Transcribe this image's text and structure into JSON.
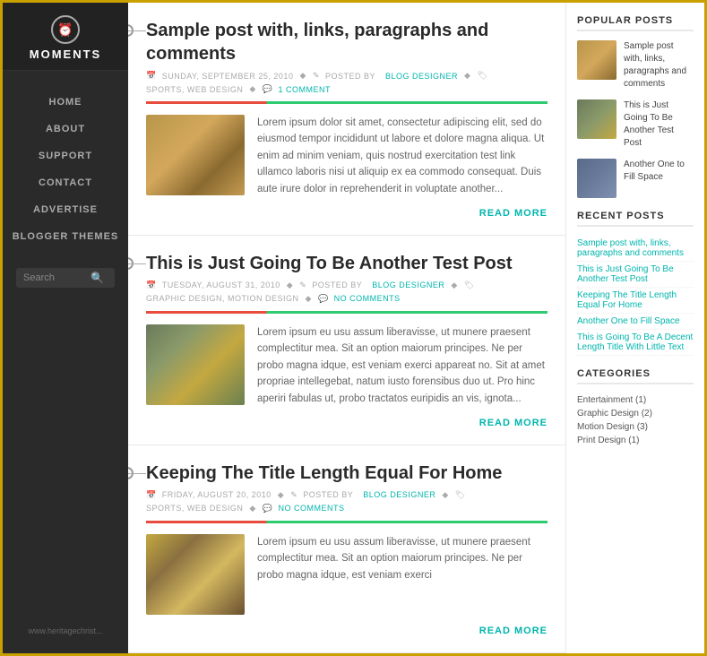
{
  "sidebar": {
    "logo_text": "MOMENTS",
    "nav_items": [
      "HOME",
      "ABOUT",
      "SUPPORT",
      "CONTACT",
      "ADVERTISE",
      "BLOGGER THEMES"
    ],
    "search_placeholder": "Search",
    "url_text": "www.heritagechrist..."
  },
  "posts": [
    {
      "id": 1,
      "title": "Sample post with, links, paragraphs and comments",
      "date": "SUNDAY, SEPTEMBER 25, 2010",
      "author": "BLOG DESIGNER",
      "tags": "SPORTS, WEB DESIGN",
      "comments": "1 COMMENT",
      "excerpt": "Lorem ipsum dolor sit amet, consectetur adipiscing elit, sed do eiusmod tempor incididunt ut labore et dolore magna aliqua. Ut enim ad minim veniam, quis nostrud exercitation test link ullamco laboris nisi ut aliquip ex ea commodo consequat. Duis aute irure dolor in reprehenderit in voluptate another...",
      "read_more": "READ MORE",
      "thumb_class": "thumb-1"
    },
    {
      "id": 2,
      "title": "This is Just Going To Be Another Test Post",
      "date": "TUESDAY, AUGUST 31, 2010",
      "author": "BLOG DESIGNER",
      "tags": "GRAPHIC DESIGN, MOTION DESIGN",
      "comments": "NO COMMENTS",
      "excerpt": "Lorem ipsum eu usu assum liberavisse, ut munere praesent complectitur mea. Sit an option maiorum principes. Ne per probo magna idque, est veniam exerci appareat no. Sit at amet propriae intellegebat, natum iusto forensibus duo ut. Pro hinc aperiri fabulas ut, probo tractatos euripidis an vis, ignota...",
      "read_more": "READ MORE",
      "thumb_class": "thumb-2"
    },
    {
      "id": 3,
      "title": "Keeping The Title Length Equal For Home",
      "date": "FRIDAY, AUGUST 20, 2010",
      "author": "BLOG DESIGNER",
      "tags": "SPORTS, WEB DESIGN",
      "comments": "NO COMMENTS",
      "excerpt": "Lorem ipsum eu usu assum liberavisse, ut munere praesent complectitur mea. Sit an option maiorum principes. Ne per probo magna idque, est veniam exerci",
      "read_more": "READ MORE",
      "thumb_class": "thumb-3"
    }
  ],
  "right_sidebar": {
    "popular_title": "POPULAR POSTS",
    "popular_posts": [
      {
        "text": "Sample post with, links, paragraphs and comments",
        "thumb_class": "pop-thumb-1"
      },
      {
        "text": "This is Just Going To Be Another Test Post",
        "thumb_class": "pop-thumb-2"
      },
      {
        "text": "Another One to Fill Space",
        "thumb_class": "pop-thumb-3"
      }
    ],
    "recent_title": "RECENT POSTS",
    "recent_posts": [
      "Sample post with, links, paragraphs and comments",
      "This is Just Going To Be Another Test Post",
      "Keeping The Title Length Equal For Home",
      "Another One to Fill Space",
      "This is Going To Be A Decent Length Title With Little Text"
    ],
    "categories_title": "CATEGORIES",
    "categories": [
      "Entertainment (1)",
      "Graphic Design (2)",
      "Motion Design (3)",
      "Print Design (1)"
    ]
  }
}
